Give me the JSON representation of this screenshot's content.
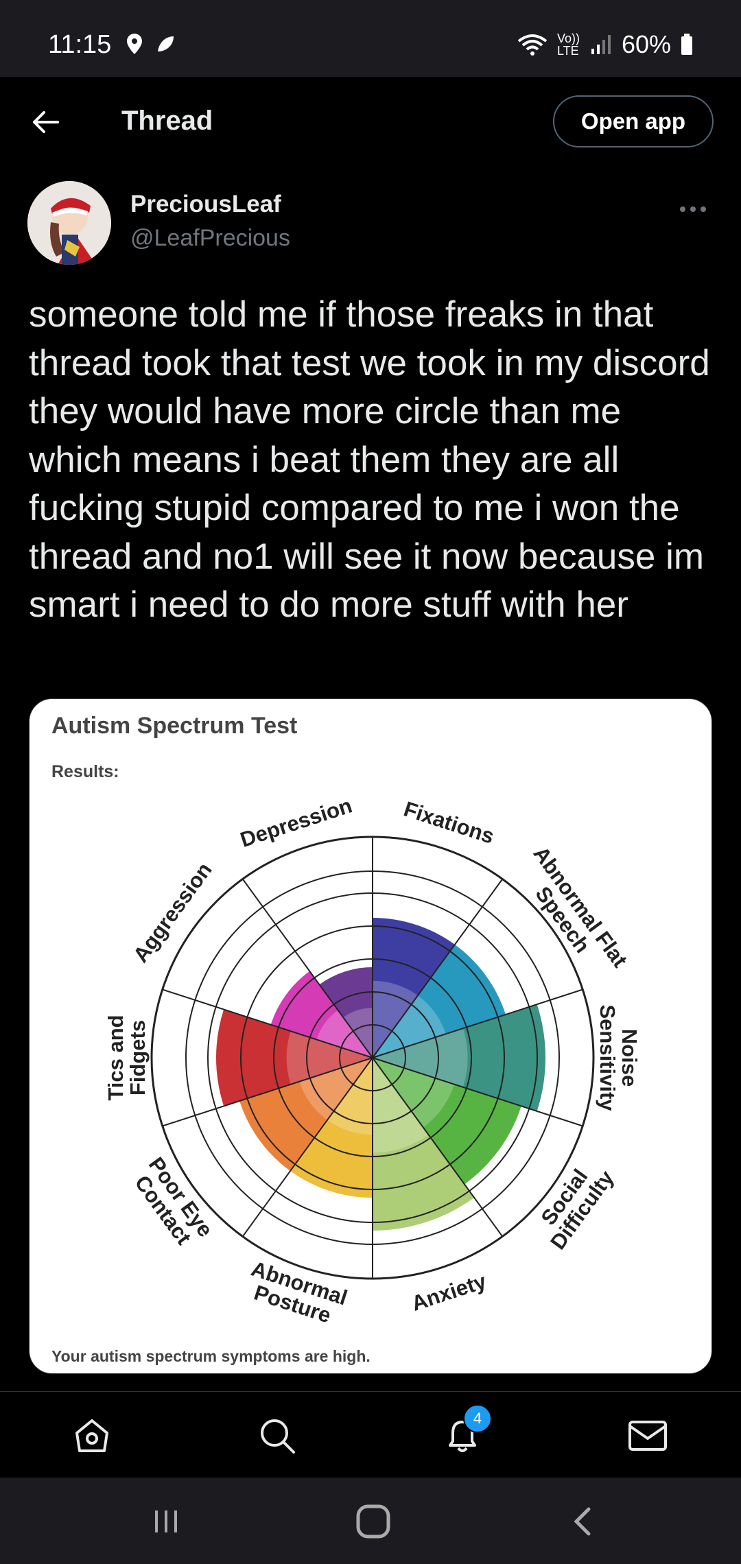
{
  "status_bar": {
    "time": "11:15",
    "network_label": "Vo)) LTE",
    "battery": "60%"
  },
  "header": {
    "title": "Thread",
    "open_app_label": "Open app"
  },
  "tweet": {
    "display_name": "PreciousLeaf",
    "handle": "@LeafPrecious",
    "text": "someone told me if those freaks in that thread took that test we took in my discord they would have more circle than me which means i beat them they are all fucking stupid compared to me i won the thread and no1 will see it now because im smart i need to do more stuff with her"
  },
  "media": {
    "title": "Autism Spectrum Test",
    "results_label": "Results:",
    "footer": "Your autism spectrum symptoms are high.",
    "chart_data": {
      "type": "radial-bar",
      "max_rings": 5,
      "categories": [
        "Fixations",
        "Abnormal Flat Speech",
        "Noise Sensitivity",
        "Social Difficulty",
        "Anxiety",
        "Abnormal Posture",
        "Poor Eye Contact",
        "Tics and Fidgets",
        "Aggression",
        "Depression"
      ],
      "values": [
        4,
        4,
        5,
        4.5,
        5,
        4,
        4,
        4.5,
        3,
        2.5
      ],
      "colors": [
        "#2e2e9a",
        "#1590b8",
        "#2a8a7a",
        "#4aae32",
        "#a6c96a",
        "#eab82a",
        "#e8762a",
        "#c42024",
        "#d22ab0",
        "#5e2a8a"
      ]
    }
  },
  "bottom_nav": {
    "notifications_badge": "4",
    "items": [
      "home-icon",
      "search-icon",
      "bell-icon",
      "mail-icon"
    ]
  }
}
